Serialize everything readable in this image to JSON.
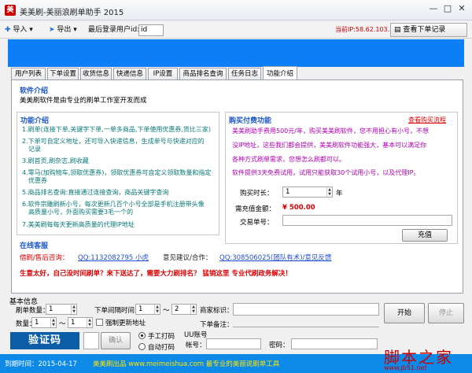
{
  "window": {
    "title": "美美刷-美丽浪刷单助手 2015",
    "icon_text": "美"
  },
  "toolbar": {
    "import_label": "导入 ▾",
    "export_label": "导出 ▾",
    "last_user_label": "最后登录用户id:",
    "last_user_value": "id",
    "current_ip": "当前IP:58.62.103.35",
    "view_orders_label": "查看下单记录"
  },
  "tabs": [
    "用户列表",
    "下单设置",
    "收货信息",
    "快递信息",
    "IP设置",
    "商品排名查询",
    "任务日志",
    "功能介绍"
  ],
  "intro": {
    "heading": "软件介绍",
    "text": "美美刷软件是由专业的刷单工作室开发而成"
  },
  "functions": {
    "heading": "功能介绍",
    "items": [
      "1.刷单(连接下单,关键字下单,一单多商品,下单使用优惠券,货比三家)",
      "2.下单可自定义地址，还可导入快递信息，生成单号与快递对应的",
      "记录",
      "3.刷首页,刷杂志,刷收藏",
      "4.零马(加购物车,领取优惠券)，领取优惠券可自定义领取数量和指定",
      "优惠券",
      "5.商品排名查询:直接通过连接查询，商品关键字查询",
      "6.软件宗雕刷新小号，每次更新几百个小号全部是手机注册带头像",
      "高质量小号，外面购买需要3毛一个的",
      "7.美美刷每每天更新高质量的代理IP地址"
    ]
  },
  "purchase": {
    "heading": "购买付费功能",
    "link": "查看购买流程",
    "notes": [
      "美美刷助手费用500元/年，购买美美刷软件，您不用担心有小号，不想",
      "没IP地址，这些我们都会提供，美美刷软件功能强大，基本可以满足你",
      "各种方式刷单需求，您想怎么刷都可以。",
      "软件提供3天免费试用，试用只能获取30个试用小号，以及代理IP。"
    ],
    "duration_label": "购买时长：",
    "duration_value": "1",
    "duration_unit": "年",
    "amount_label": "需充值金额：",
    "amount_value": "¥ 500.00",
    "trade_label": "交易单号：",
    "trade_value": "",
    "recharge_button": "充值"
  },
  "online": {
    "heading": "在线客服",
    "qq_label": "借刷/售后咨询：",
    "qq_value": "QQ:1132082795 小虎",
    "feedback_label": "意见建议/合作：",
    "feedback_value": "QQ:308506025(团队有术)/意见反馈",
    "slogan": "生意太好，自己没时间刷单？来下送达了，需要大力刷排名？ 猛销这里 专业代刷政务解决！"
  },
  "basic": {
    "heading": "基本信息",
    "order_count_label": "刷单数量：",
    "order_count_value": "1",
    "interval_label": "下单间隔时间：",
    "interval_from": "1",
    "interval_sep": "～",
    "interval_to": "2",
    "shop_label": "商家标识：",
    "shop_value": "",
    "start_button": "开始",
    "stop_button": "停止",
    "qty_label": "数量：",
    "qty_from": "1",
    "qty_sep": "～",
    "qty_to": "1",
    "force_address_label": "强制更新地址",
    "order_note_label": "下单备注：",
    "order_note_value": ""
  },
  "captcha": {
    "label": "验证码",
    "confirm_button": "确认",
    "manual_label": "手工打码",
    "auto_label": "自动打码",
    "uu_label": "UU账号",
    "account_label": "帐号：",
    "password_label": "密码："
  },
  "status": {
    "expire": "到期时间：2015-04-17",
    "site": "美美刷出品 www.meimeishua.com   最专业的美丽说刷单工具"
  },
  "watermark": {
    "main": "脚本之家",
    "sub": "www.jb51.net"
  }
}
